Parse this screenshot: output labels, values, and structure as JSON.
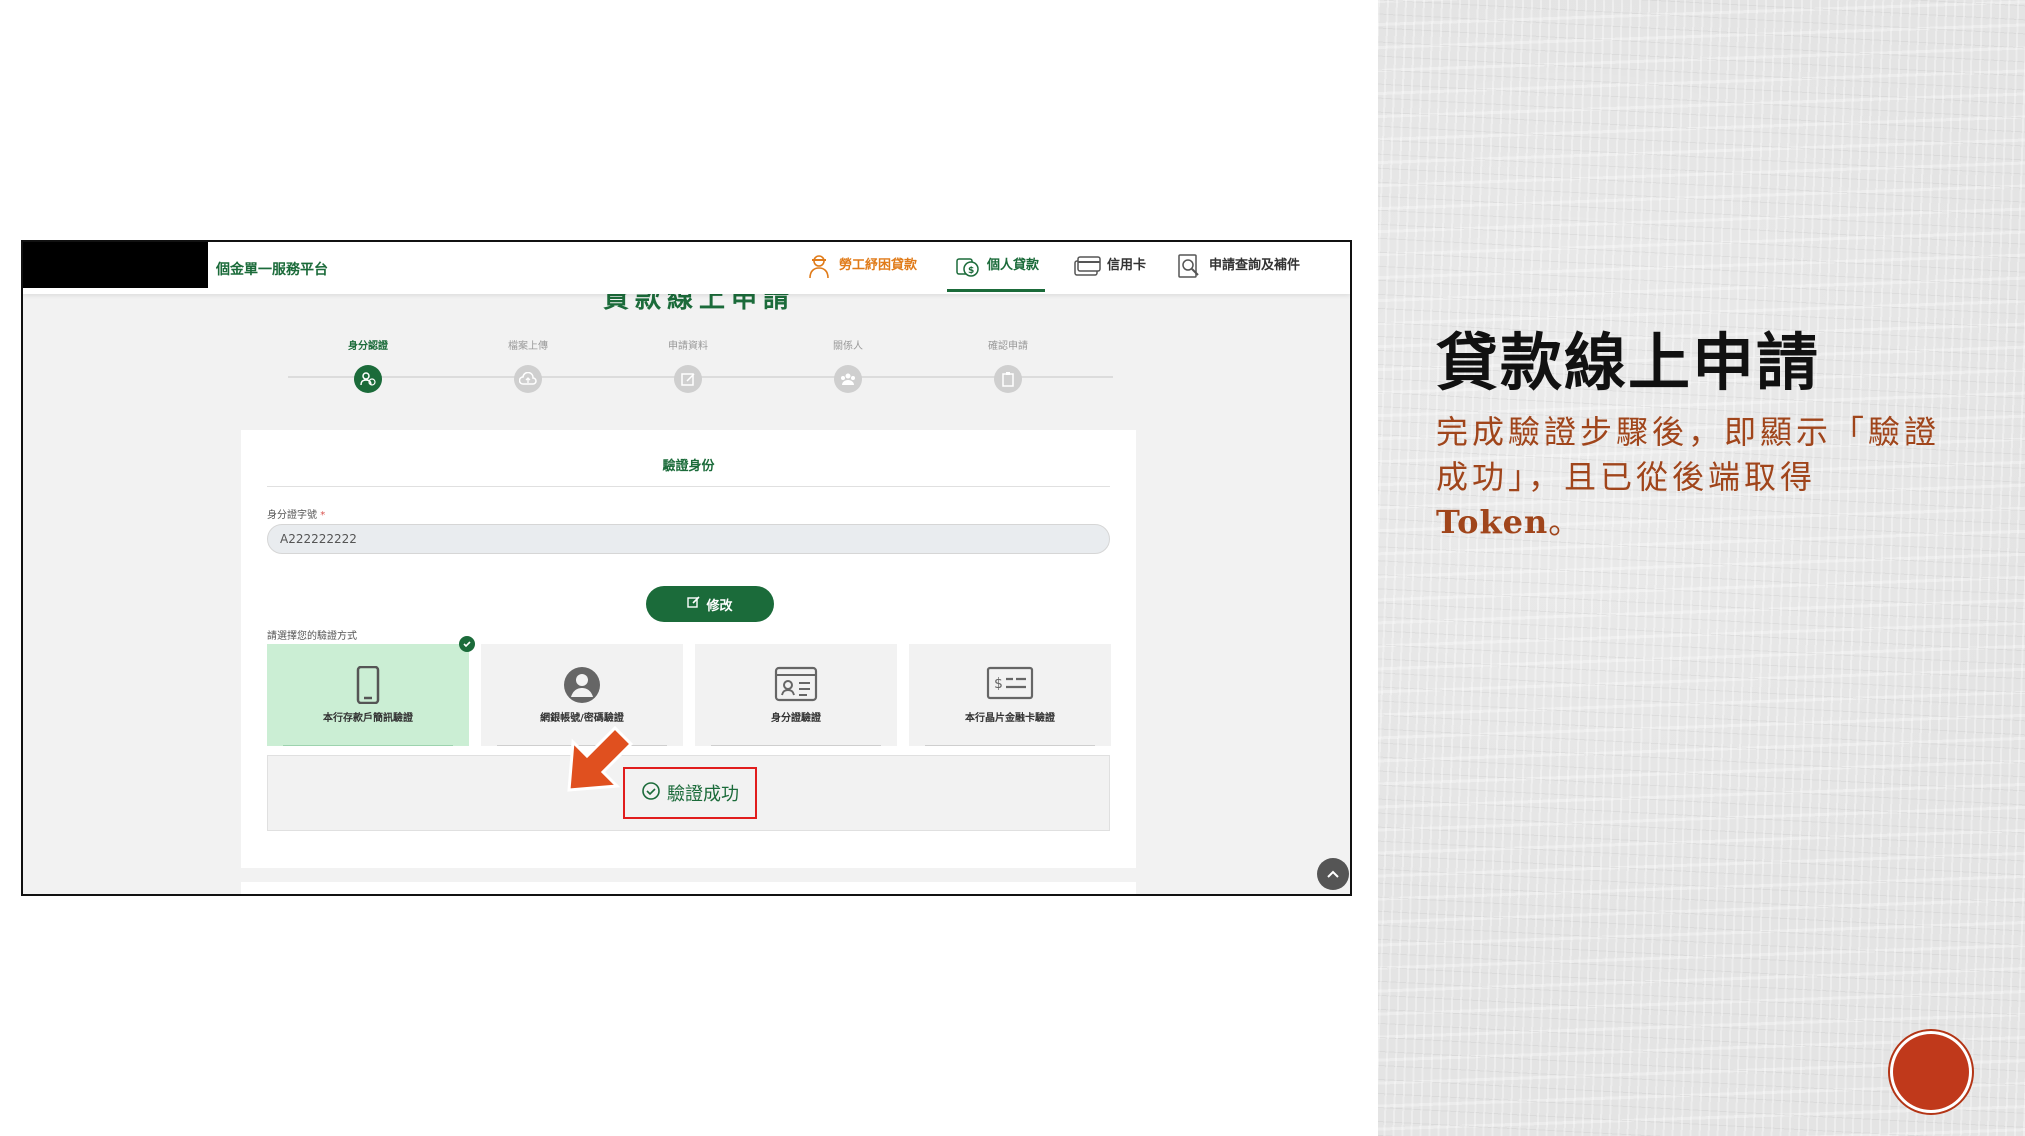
{
  "slide": {
    "title": "貸款線上申請",
    "body_text": "完成驗證步驟後，即顯示「驗證成功」，且已從後端取得",
    "body_token": "Token",
    "body_end": "。"
  },
  "app": {
    "platform_name": "個金單一服務平台",
    "nav": {
      "labor_loan": "勞工紓困貸款",
      "personal_loan": "個人貸款",
      "credit_card": "信用卡",
      "inquiry": "申請查詢及補件"
    },
    "page_heading": "貸款線上申請",
    "steps": [
      {
        "label": "身分認證",
        "active": true
      },
      {
        "label": "檔案上傳",
        "active": false
      },
      {
        "label": "申請資料",
        "active": false
      },
      {
        "label": "關係人",
        "active": false
      },
      {
        "label": "確認申請",
        "active": false
      }
    ],
    "verify": {
      "title": "驗證身份",
      "id_label": "身分證字號",
      "required_mark": "*",
      "id_value": "A222222222",
      "edit_button": "修改",
      "method_prompt": "請選擇您的驗證方式",
      "methods": [
        {
          "label": "本行存款戶簡訊驗證",
          "icon": "mobile-phone-icon",
          "selected": true
        },
        {
          "label": "網銀帳號/密碼驗證",
          "icon": "user-avatar-icon",
          "selected": false
        },
        {
          "label": "身分證驗證",
          "icon": "id-card-icon",
          "selected": false
        },
        {
          "label": "本行晶片金融卡驗證",
          "icon": "chip-card-icon",
          "selected": false
        }
      ],
      "success_text": "驗證成功"
    }
  },
  "colors": {
    "brand_green": "#1b6b3a",
    "labor_orange": "#e07b19",
    "selected_bg": "#cbeed4",
    "highlight_red": "#e11d1d",
    "arrow_orange": "#e0501f",
    "slide_body": "#a0451b",
    "slide_dot": "#c0391b"
  }
}
